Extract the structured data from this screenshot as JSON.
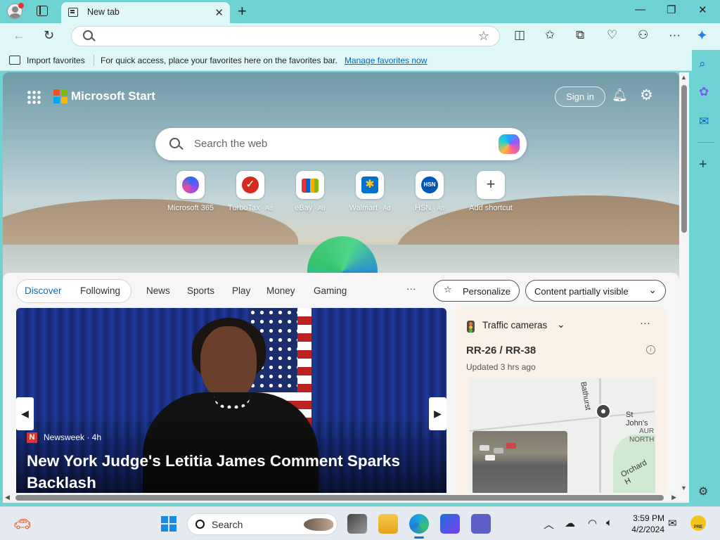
{
  "browser": {
    "tab_title": "New tab",
    "address_value": "",
    "favorites_bar": {
      "import_label": "Import favorites",
      "message": "For quick access, place your favorites here on the favorites bar.",
      "manage_link": "Manage favorites now"
    }
  },
  "start": {
    "brand": "Microsoft Start",
    "sign_in": "Sign in",
    "search_placeholder": "Search the web",
    "shortcuts": [
      {
        "label": "Microsoft 365",
        "ad": ""
      },
      {
        "label": "TurboTax",
        "ad": " · Ad"
      },
      {
        "label": "eBay",
        "ad": " · Ad"
      },
      {
        "label": "Walmart",
        "ad": " · Ad"
      },
      {
        "label": "HSN",
        "ad": " · Ad"
      },
      {
        "label": "Add shortcut",
        "ad": ""
      }
    ],
    "hsn_logo_text": "HSN"
  },
  "feed": {
    "tabs": [
      "Discover",
      "Following",
      "News",
      "Sports",
      "Play",
      "Money",
      "Gaming"
    ],
    "more": "···",
    "personalize": "Personalize",
    "content_visibility": "Content partially visible",
    "hero": {
      "source_badge": "N",
      "source": "Newsweek · 4h",
      "headline": "New York Judge's Letitia James Comment Sparks Backlash"
    },
    "traffic": {
      "title": "Traffic cameras",
      "route": "RR-26 / RR-38",
      "updated": "Updated 3 hrs ago",
      "map_labels": [
        "Bathurst",
        "St John's",
        "AUR",
        "NORTH",
        "Orchard H"
      ]
    }
  },
  "taskbar": {
    "search_label": "Search",
    "time": "3:59 PM",
    "date": "4/2/2024",
    "pre_badge": "PRE"
  },
  "colors": {
    "frame": "#6fd3d3",
    "toolbar": "#dff7f7",
    "accent": "#0f6cbd",
    "link": "#0067b8"
  },
  "icons": [
    "profile-icon",
    "tab-actions-icon",
    "close-icon",
    "add-tab-icon",
    "minimize-icon",
    "restore-icon",
    "back-icon",
    "refresh-icon",
    "search-icon",
    "favorite-star-icon",
    "split-screen-icon",
    "favorites-icon",
    "collections-icon",
    "browser-essentials-icon",
    "extensions-icon",
    "more-icon",
    "copilot-icon",
    "bell-icon",
    "gear-icon",
    "apps-icon",
    "traffic-light-icon",
    "chevron-down-icon",
    "camera-pin-icon",
    "windows-start-icon"
  ]
}
